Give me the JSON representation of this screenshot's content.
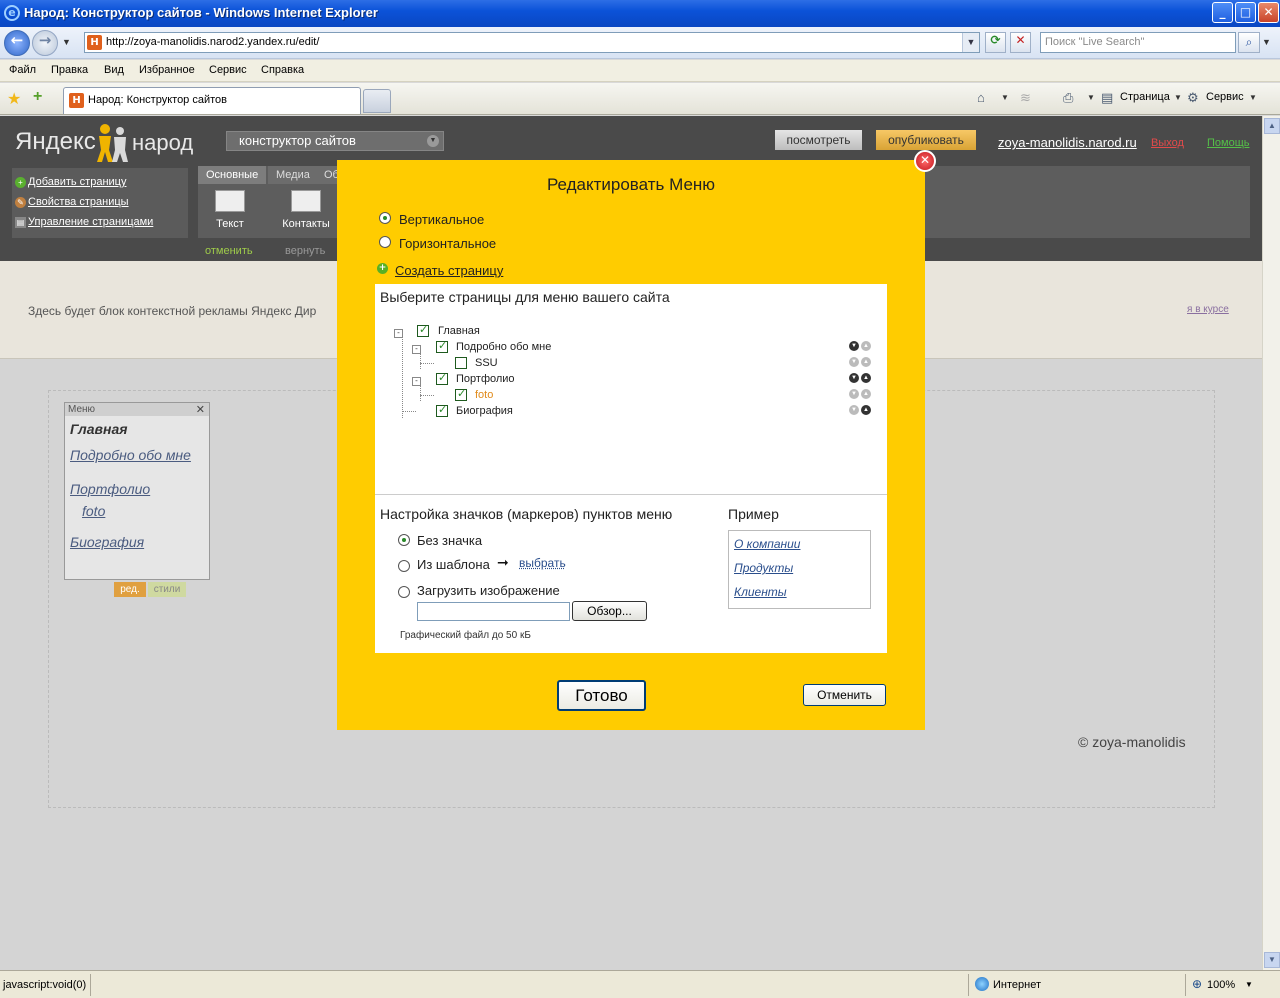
{
  "window": {
    "title": "Народ: Конструктор сайтов - Windows Internet Explorer",
    "minimize": "_",
    "maximize": "□",
    "close": "✕"
  },
  "address": {
    "url": "http://zoya-manolidis.narod2.yandex.ru/edit/",
    "search_placeholder": "Поиск \"Live Search\""
  },
  "menubar": [
    "Файл",
    "Правка",
    "Вид",
    "Избранное",
    "Сервис",
    "Справка"
  ],
  "tab": {
    "label": "Народ: Конструктор сайтов"
  },
  "toolbar": {
    "page": "Страница",
    "service": "Сервис"
  },
  "yandex": {
    "logo": "Яндекс",
    "logo2": "народ",
    "selector": "конструктор сайтов",
    "view_btn": "посмотреть",
    "publish_btn": "опубликовать",
    "site": "zoya-manolidis.narod.ru",
    "exit": "Выход",
    "help": "Помощь",
    "panel_items": [
      "Добавить страницу",
      "Свойства страницы",
      "Управление страницами"
    ],
    "tabs": [
      "Основные",
      "Медиа",
      "Об"
    ],
    "tools": [
      "Текст",
      "Контакты"
    ],
    "undo": "отменить",
    "redo": "вернуть",
    "ad_text": "Здесь будет блок контекстной рекламы Яндекс Дир",
    "ad_right": "я в курсе",
    "copyright": "© zoya-manolidis"
  },
  "menu_widget": {
    "header": "Меню",
    "items": [
      "Главная",
      "Подробно обо мне",
      "Портфолио",
      "foto",
      "Биография"
    ],
    "edit": "ред.",
    "styles": "стили"
  },
  "modal": {
    "title": "Редактировать Меню",
    "orientation": [
      "Вертикальное",
      "Горизонтальное"
    ],
    "orientation_selected": "Вертикальное",
    "add_page": "Создать страницу",
    "select_title": "Выберите страницы для меню вашего сайта",
    "tree": [
      {
        "label": "Главная",
        "checked": true,
        "level": 0
      },
      {
        "label": "Подробно обо мне",
        "checked": true,
        "level": 1
      },
      {
        "label": "SSU",
        "checked": false,
        "level": 2
      },
      {
        "label": "Портфолио",
        "checked": true,
        "level": 1
      },
      {
        "label": "foto",
        "checked": true,
        "level": 2
      },
      {
        "label": "Биография",
        "checked": true,
        "level": 1
      }
    ],
    "markers_title": "Настройка значков (маркеров) пунктов меню",
    "markers": [
      "Без значка",
      "Из шаблона",
      "Загрузить изображение"
    ],
    "markers_selected": "Без значка",
    "choose": "выбрать",
    "browse": "Обзор...",
    "hint": "Графический файл до 50 кБ",
    "example_title": "Пример",
    "example_items": [
      "О компании",
      "Продукты",
      "Клиенты"
    ],
    "done": "Готово",
    "cancel": "Отменить"
  },
  "status": {
    "text": "javascript:void(0)",
    "zone": "Интернет",
    "zoom": "100%"
  }
}
